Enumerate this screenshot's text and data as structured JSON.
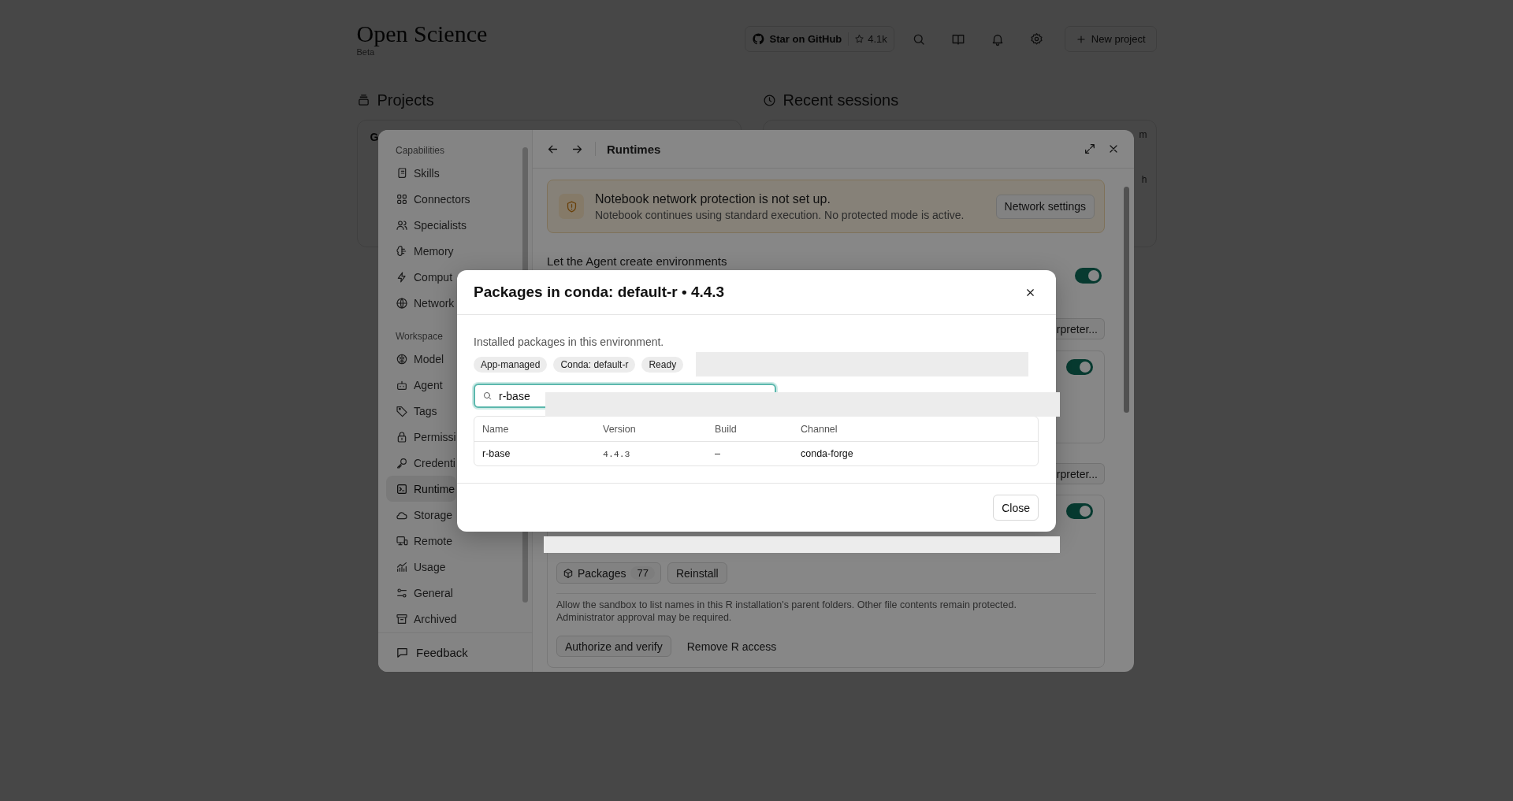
{
  "app": {
    "title": "Open Science",
    "badge": "Beta"
  },
  "header_actions": {
    "github_label": "Star on GitHub",
    "github_stars": "4.1k",
    "new_project": "New project"
  },
  "sections": [
    {
      "title": "Projects",
      "card_lines": [
        "G"
      ]
    },
    {
      "title": "Recent sessions",
      "card_lines": [
        "m",
        "h"
      ]
    }
  ],
  "settings": {
    "sidebar": {
      "groups": [
        {
          "title": "Capabilities",
          "items": [
            {
              "label": "Skills",
              "selected": false
            },
            {
              "label": "Connectors",
              "selected": false
            },
            {
              "label": "Specialists",
              "selected": false
            },
            {
              "label": "Memory",
              "selected": false
            },
            {
              "label": "Comput",
              "selected": false
            },
            {
              "label": "Network",
              "selected": false
            }
          ]
        },
        {
          "title": "Workspace",
          "items": [
            {
              "label": "Model",
              "selected": false
            },
            {
              "label": "Agent",
              "selected": false
            },
            {
              "label": "Tags",
              "selected": false
            },
            {
              "label": "Permissi",
              "selected": false
            },
            {
              "label": "Credenti",
              "selected": false
            },
            {
              "label": "Runtime",
              "selected": true
            },
            {
              "label": "Storage",
              "selected": false
            },
            {
              "label": "Remote",
              "selected": false
            },
            {
              "label": "Usage",
              "selected": false
            },
            {
              "label": "General",
              "selected": false
            },
            {
              "label": "Archived",
              "selected": false
            }
          ]
        }
      ],
      "footer": "Feedback"
    },
    "title": "Runtimes",
    "banner": {
      "title": "Notebook network protection is not set up.",
      "text": "Notebook continues using standard execution. No protected mode is active.",
      "button": "Network settings"
    },
    "agent_env": {
      "label": "Let the Agent create environments",
      "on": true
    },
    "interpreter_buttons": [
      "rpreter...",
      "rpreter..."
    ],
    "runtime_cards": [
      {
        "on": true
      },
      {
        "on": true,
        "packages_label": "Packages",
        "packages_count": "77",
        "reinstall": "Reinstall",
        "note": "Allow the sandbox to list names in this R installation's parent folders. Other file contents remain protected. Administrator approval may be required.",
        "authorize": "Authorize and verify",
        "remove": "Remove R access"
      }
    ]
  },
  "modal": {
    "title": "Packages in conda: default-r • 4.4.3",
    "description": "Installed packages in this environment.",
    "chips": [
      "App-managed",
      "Conda: default-r",
      "Ready"
    ],
    "search": {
      "value": "r-base"
    },
    "table": {
      "columns": [
        "Name",
        "Version",
        "Build",
        "Channel"
      ],
      "rows": [
        [
          "r-base",
          "4.4.3",
          "–",
          "conda-forge"
        ]
      ]
    },
    "close_button": "Close"
  }
}
